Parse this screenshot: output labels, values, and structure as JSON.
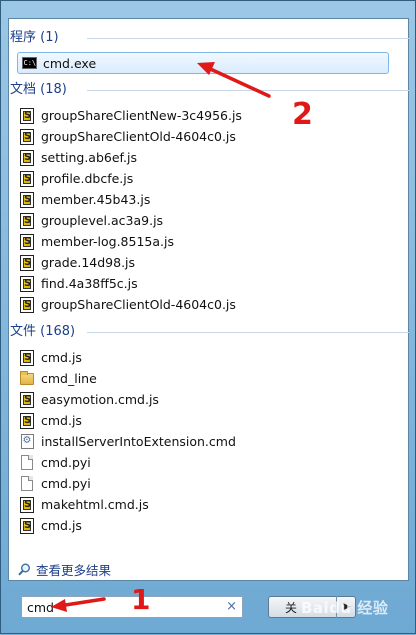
{
  "sections": {
    "programs": {
      "header": "程序 (1)",
      "items": [
        {
          "label": "cmd.exe",
          "icon": "cmd-console-icon"
        }
      ]
    },
    "documents": {
      "header": "文档 (18)",
      "items": [
        {
          "label": "groupShareClientNew-3c4956.js",
          "icon": "js-file-icon"
        },
        {
          "label": "groupShareClientOld-4604c0.js",
          "icon": "js-file-icon"
        },
        {
          "label": "setting.ab6ef.js",
          "icon": "js-file-icon"
        },
        {
          "label": "profile.dbcfe.js",
          "icon": "js-file-icon"
        },
        {
          "label": "member.45b43.js",
          "icon": "js-file-icon"
        },
        {
          "label": "grouplevel.ac3a9.js",
          "icon": "js-file-icon"
        },
        {
          "label": "member-log.8515a.js",
          "icon": "js-file-icon"
        },
        {
          "label": "grade.14d98.js",
          "icon": "js-file-icon"
        },
        {
          "label": "find.4a38ff5c.js",
          "icon": "js-file-icon"
        },
        {
          "label": "groupShareClientOld-4604c0.js",
          "icon": "js-file-icon"
        }
      ]
    },
    "files": {
      "header": "文件 (168)",
      "items": [
        {
          "label": "cmd.js",
          "icon": "js-file-icon"
        },
        {
          "label": "cmd_line",
          "icon": "folder-icon"
        },
        {
          "label": "easymotion.cmd.js",
          "icon": "js-file-icon"
        },
        {
          "label": "cmd.js",
          "icon": "js-file-icon"
        },
        {
          "label": "installServerIntoExtension.cmd",
          "icon": "cmd-script-icon"
        },
        {
          "label": "cmd.pyi",
          "icon": "blank-file-icon"
        },
        {
          "label": "cmd.pyi",
          "icon": "blank-file-icon"
        },
        {
          "label": "makehtml.cmd.js",
          "icon": "js-file-icon"
        },
        {
          "label": "cmd.js",
          "icon": "js-file-icon"
        }
      ]
    }
  },
  "see_more": "查看更多结果",
  "search": {
    "value": "cmd",
    "clear": "×"
  },
  "shutdown": {
    "label": "关",
    "arrow": "▶"
  },
  "annotations": {
    "one": "1",
    "two": "2"
  },
  "watermark": "Baidu 经验",
  "colors": {
    "accent": "#1e3f8a",
    "selection": "#d9ecfd",
    "annotation": "#e01818"
  }
}
